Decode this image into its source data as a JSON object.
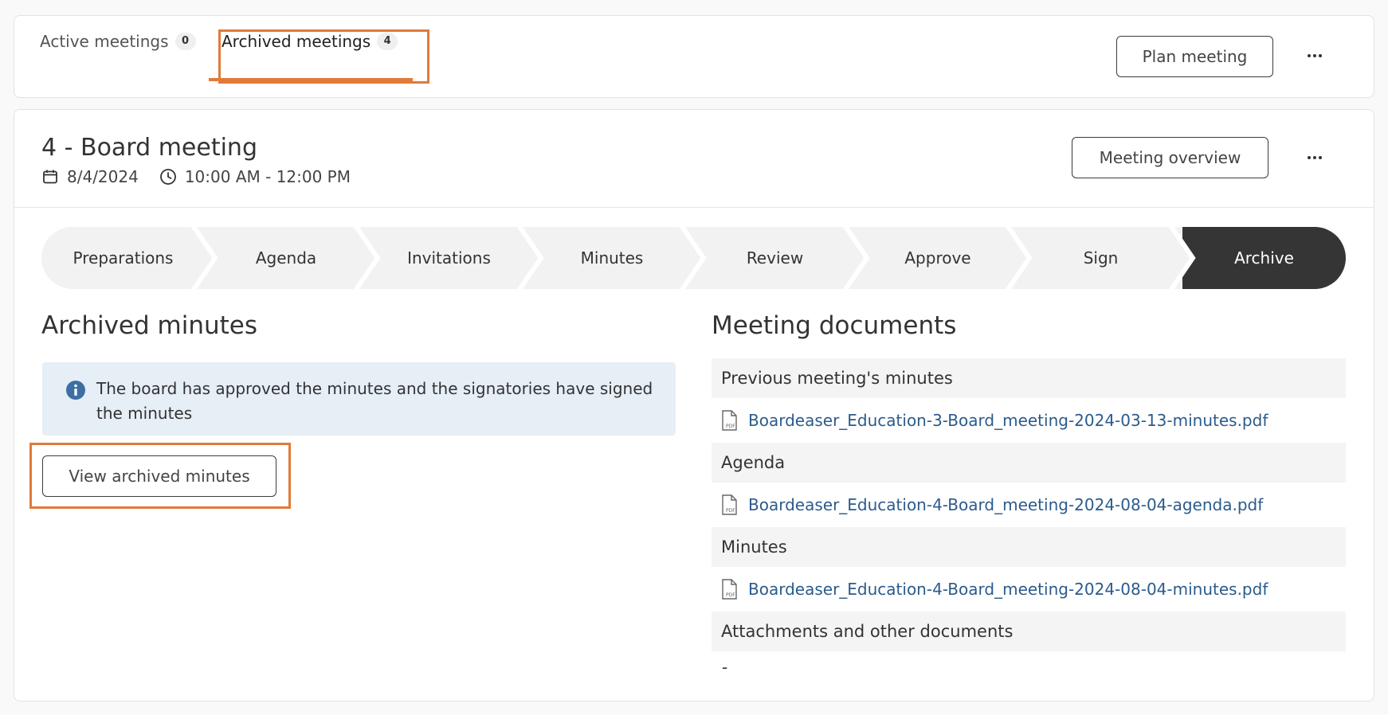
{
  "tabs": [
    {
      "label": "Active meetings",
      "count": "0"
    },
    {
      "label": "Archived meetings",
      "count": "4"
    }
  ],
  "header_actions": {
    "plan_meeting": "Plan meeting",
    "overview": "Meeting overview"
  },
  "meeting": {
    "title": "4 - Board meeting",
    "date": "8/4/2024",
    "time": "10:00 AM - 12:00 PM"
  },
  "steps": [
    "Preparations",
    "Agenda",
    "Invitations",
    "Minutes",
    "Review",
    "Approve",
    "Sign",
    "Archive"
  ],
  "active_step": "Archive",
  "archived_minutes": {
    "title": "Archived minutes",
    "info": "The board has approved the minutes and the signatories have signed the minutes",
    "view_button": "View archived minutes"
  },
  "documents": {
    "title": "Meeting documents",
    "sections": [
      {
        "header": "Previous meeting's minutes",
        "file": "Boardeaser_Education-3-Board_meeting-2024-03-13-minutes.pdf"
      },
      {
        "header": "Agenda",
        "file": "Boardeaser_Education-4-Board_meeting-2024-08-04-agenda.pdf"
      },
      {
        "header": "Minutes",
        "file": "Boardeaser_Education-4-Board_meeting-2024-08-04-minutes.pdf"
      },
      {
        "header": "Attachments and other documents",
        "file": "-"
      }
    ]
  },
  "colors": {
    "highlight": "#e07b39",
    "link": "#2b5b8c",
    "active_step": "#353535",
    "info_bg": "#e6eef6"
  },
  "icons": [
    "calendar-icon",
    "clock-icon",
    "info-icon",
    "pdf-file-icon",
    "more-options-icon"
  ]
}
